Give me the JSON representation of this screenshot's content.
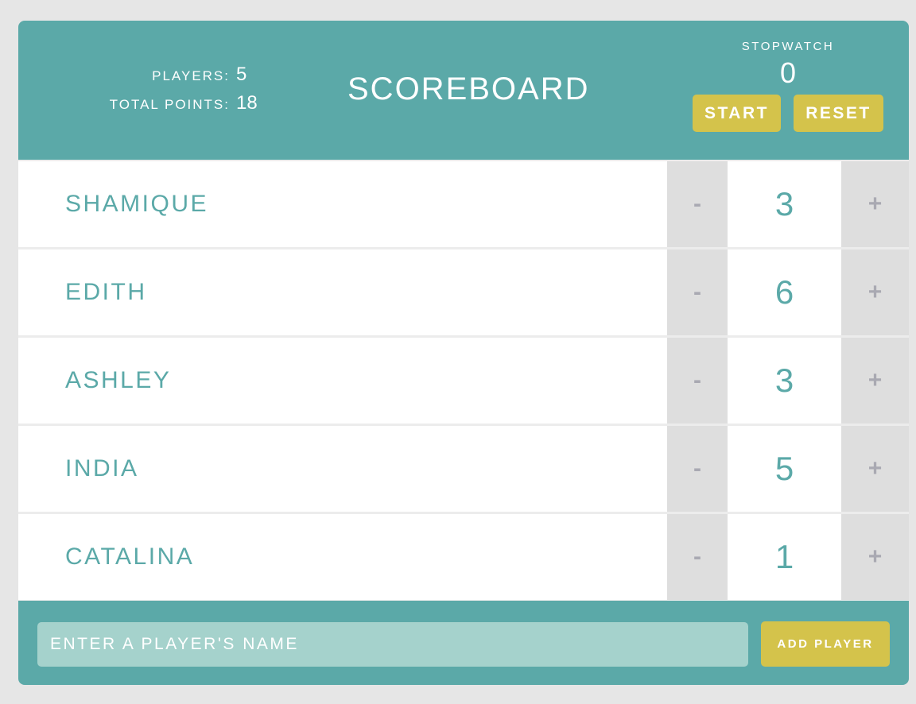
{
  "header": {
    "title": "SCOREBOARD",
    "stats": {
      "players_label": "PLAYERS:",
      "players_value": "5",
      "total_label": "TOTAL POINTS:",
      "total_value": "18"
    },
    "stopwatch": {
      "label": "STOPWATCH",
      "value": "0",
      "start_label": "START",
      "reset_label": "RESET"
    }
  },
  "players": [
    {
      "name": "SHAMIQUE",
      "score": "3",
      "dec_label": "-",
      "inc_label": "+"
    },
    {
      "name": "EDITH",
      "score": "6",
      "dec_label": "-",
      "inc_label": "+"
    },
    {
      "name": "ASHLEY",
      "score": "3",
      "dec_label": "-",
      "inc_label": "+"
    },
    {
      "name": "INDIA",
      "score": "5",
      "dec_label": "-",
      "inc_label": "+"
    },
    {
      "name": "CATALINA",
      "score": "1",
      "dec_label": "-",
      "inc_label": "+"
    }
  ],
  "footer": {
    "input_placeholder": "ENTER A PLAYER'S NAME",
    "input_value": "",
    "add_label": "ADD PLAYER"
  },
  "colors": {
    "primary": "#5ba9a8",
    "accent": "#d4c34b",
    "input_bg": "#a5d2cc",
    "counter_bg": "#dedede",
    "page_bg": "#e6e6e6"
  }
}
